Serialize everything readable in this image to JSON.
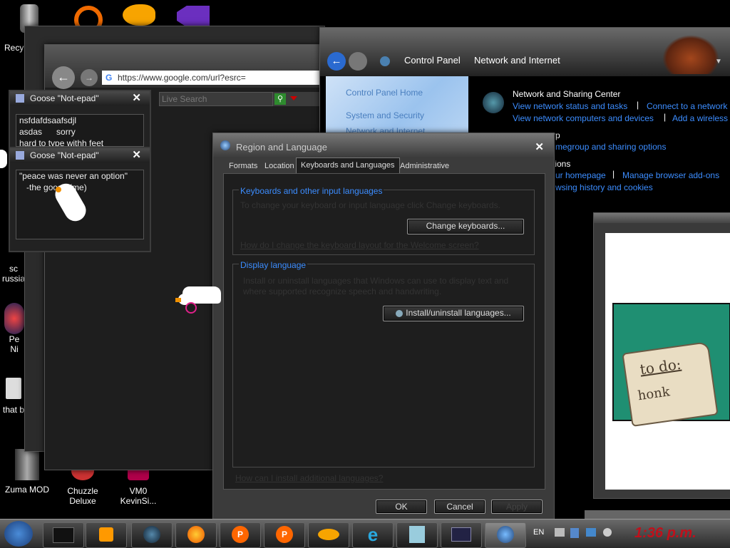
{
  "desktop": {
    "icons": [
      {
        "label": "Recy",
        "icon": "recycle-bin-icon"
      },
      {
        "label": "sc\nrussia",
        "icon": "file-icon"
      },
      {
        "label": "Pe\nNi",
        "icon": "game-icon"
      },
      {
        "label": "that b",
        "icon": "bag-icon"
      },
      {
        "label": "Zuma MOD",
        "icon": "zuma-icon"
      },
      {
        "label": "Chuzzle\nDeluxe",
        "icon": "chuzzle-icon"
      },
      {
        "label": "VM0\nKevinSi...",
        "icon": "vm-icon"
      }
    ]
  },
  "browser": {
    "url": "https://www.google.com/url?esrc=",
    "search_placeholder": "Live Search"
  },
  "goose_notes": [
    {
      "title": "Goose \"Not-epad\"",
      "text": "nsfdafdsaafsdjl\nasdas      sorry\nhard to type withh feet"
    },
    {
      "title": "Goose \"Not-epad\"",
      "text": "\"peace was never an option\"\n   -the goose (me)"
    }
  ],
  "control_panel": {
    "breadcrumb": [
      "Control Panel",
      "Network and Internet"
    ],
    "sidebar": [
      "Control Panel Home",
      "System and Security",
      "Network and Internet"
    ],
    "sections": [
      {
        "title": "Network and Sharing Center",
        "links": [
          "View network status and tasks",
          "Connect to a network",
          "View network computers and devices",
          "Add a wireless"
        ]
      },
      {
        "title": "rp",
        "links": [
          "megroup and sharing options"
        ]
      },
      {
        "title": "tions",
        "links": [
          "ur homepage",
          "Manage browser add-ons",
          "wsing history and cookies"
        ]
      }
    ]
  },
  "region_dialog": {
    "title": "Region and Language",
    "tabs": [
      "Formats",
      "Location",
      "Keyboards and Languages",
      "Administrative"
    ],
    "active_tab": 2,
    "keyboards_group": "Keyboards and other input languages",
    "keyboards_text": "To change your keyboard or input language click Change keyboards.",
    "change_keyboards": "Change keyboards...",
    "welcome_link": "How do I change the keyboard layout for the Welcome screen?",
    "display_group": "Display language",
    "display_text": "Install or uninstall languages that Windows can use to display text and\nwhere supported recognize speech and handwriting.",
    "install_button": "Install/uninstall languages...",
    "install_link": "How can I install additional languages?",
    "ok": "OK",
    "cancel": "Cancel",
    "apply": "Apply"
  },
  "note_card": {
    "line1": "to do:",
    "line2": "honk"
  },
  "taskbar": {
    "lang": "EN",
    "time": "1:36 p.m.",
    "items": [
      "terminal",
      "media-player",
      "globe",
      "firefox",
      "popcap",
      "popcap2",
      "goldfish",
      "ie",
      "notepad",
      "screen",
      "control-panel"
    ]
  },
  "colors": {
    "accent_link": "#3c8dff",
    "clock": "#c0101b",
    "teal": "#1f8f72"
  }
}
